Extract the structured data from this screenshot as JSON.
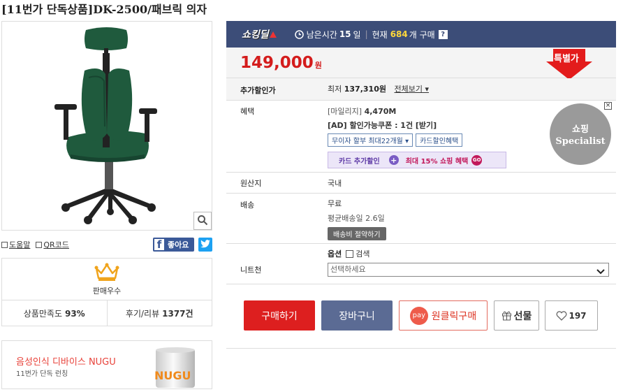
{
  "product": {
    "title": "[11번가 단독상품]DK-2500/패브릭 의자"
  },
  "image_tools": {
    "help": "도움말",
    "qr": "QR코드",
    "like": "좋아요"
  },
  "seller": {
    "grade": "판매우수",
    "satisfaction_label": "상품만족도",
    "satisfaction_value": "93%",
    "review_label": "후기/리뷰",
    "review_value": "1377건"
  },
  "banner": {
    "title": "음성인식 디바이스 NUGU",
    "subtitle": "11번가 단독 런칭",
    "can_text": "NUGU"
  },
  "deal": {
    "logo": "쇼킹딜",
    "remaining_label": "남은시간",
    "remaining_value": "15",
    "remaining_unit": "일",
    "current_label": "현재",
    "current_value": "684",
    "current_unit": "개 구매",
    "help": "?"
  },
  "price": {
    "value": "149,000",
    "unit": "원",
    "special_label": "특별가"
  },
  "discount": {
    "label": "추가할인가",
    "prefix": "최저",
    "value": "137,310원",
    "view_all": "전체보기"
  },
  "benefit": {
    "label": "혜택",
    "mileage_label": "[마일리지]",
    "mileage_value": "4,470M",
    "coupon": "[AD] 할인가능쿠폰 : 1건 [받기]",
    "chip_installment": "무이자 할부 최대22개월",
    "chip_card": "카드할인혜택",
    "card_extra": "카드 추가할인",
    "shopping_benefit": "최대 15% 쇼핑 혜택",
    "go": "GO"
  },
  "ad": {
    "line1": "쇼핑",
    "line2": "Specialist",
    "close": "×"
  },
  "origin": {
    "label": "원산지",
    "value": "국내"
  },
  "shipping": {
    "label": "배송",
    "fee": "무료",
    "average": "평균배송일 2.6일",
    "save_button": "배송비 절약하기"
  },
  "option": {
    "label": "니트천",
    "title": "옵션",
    "search": "검색",
    "placeholder": "선택하세요"
  },
  "actions": {
    "buy": "구매하기",
    "cart": "장바구니",
    "pay": "pay",
    "oneclick": "원클릭구매",
    "gift": "선물",
    "likes": "197"
  },
  "colors": {
    "deal_bar": "#3c4d78",
    "price_red": "#d41c1c",
    "buy_red": "#dd1f1f",
    "cart_blue": "#5b6b94",
    "chair_green": "#1f5a3d"
  }
}
